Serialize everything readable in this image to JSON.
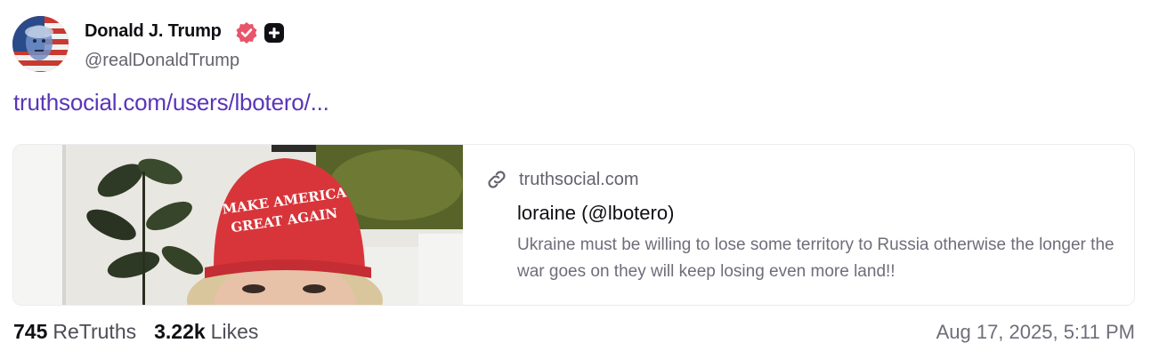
{
  "author": {
    "name": "Donald J. Trump",
    "handle": "@realDonaldTrump"
  },
  "post": {
    "link_text": "truthsocial.com/users/lbotero/..."
  },
  "card": {
    "domain": "truthsocial.com",
    "title": "loraine (@lbotero)",
    "description": "Ukraine must be willing to lose some territory to Russia otherwise the longer the war goes on they will keep losing even more land!!",
    "thumbnail_hat_text_line1": "MAKE AMERICA",
    "thumbnail_hat_text_line2": "GREAT AGAIN"
  },
  "stats": {
    "retruths_count": "745",
    "retruths_label": "ReTruths",
    "likes_count": "3.22k",
    "likes_label": "Likes"
  },
  "timestamp": "Aug 17, 2025, 5:11 PM",
  "colors": {
    "link": "#5a35b8",
    "verified_badge": "#e8546a",
    "hat_red": "#d8353a"
  },
  "icons": {
    "verified": "verified-badge-icon",
    "plus": "plus-square-icon",
    "link": "link-chain-icon"
  }
}
